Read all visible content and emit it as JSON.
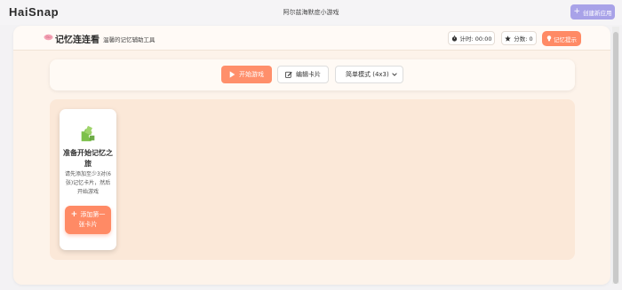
{
  "topbar": {
    "brand": "HaiSnap",
    "window_title": "阿尔兹海默症小游戏",
    "create_button": "创建新应用",
    "create_icon": "plus-icon"
  },
  "header": {
    "title": "记忆连连看",
    "subtitle": "温馨的记忆辅助工具",
    "logo_icon": "brain-icon",
    "timer_label": "计时: 00:00",
    "timer_icon": "stopwatch-icon",
    "score_label": "分数: 0",
    "score_icon": "star-icon",
    "hint_button": "记忆提示",
    "hint_icon": "lightbulb-icon"
  },
  "controls": {
    "start_button": "开始游戏",
    "start_icon": "play-icon",
    "edit_button": "编辑卡片",
    "edit_icon": "edit-icon",
    "mode_select": "简单模式 (4x3)",
    "select_icon": "chevron-down-icon"
  },
  "board": {
    "card": {
      "icon": "puzzle-icon",
      "title": "准备开始记忆之旅",
      "description": "请先添加至少3对(6张)记忆卡片，然后开始游戏",
      "add_button": "添加第一张卡片",
      "add_icon": "plus-icon"
    }
  },
  "colors": {
    "accent": "#ff8a65",
    "create_button": "#a8a2e8",
    "board_background": "#fbe8d8"
  }
}
